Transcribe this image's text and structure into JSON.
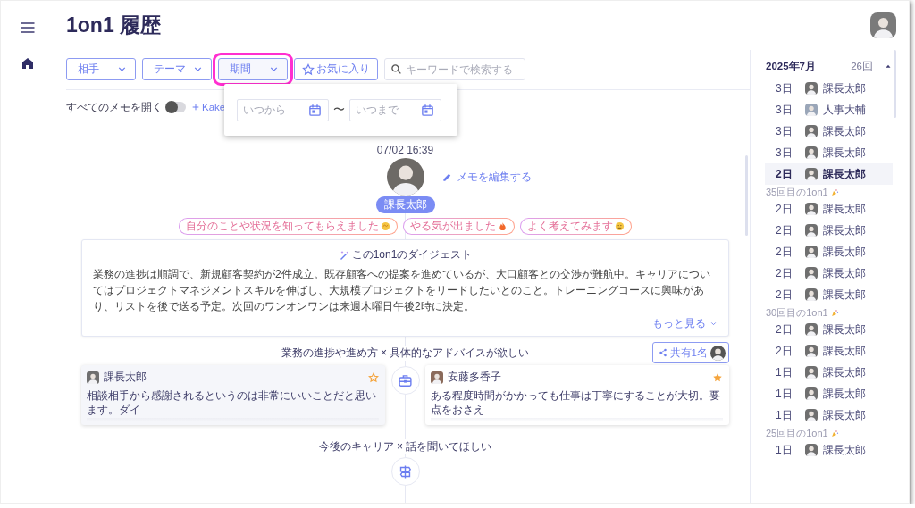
{
  "page": {
    "title": "1on1 履歴"
  },
  "filters": [
    {
      "kind": "dropdown",
      "label": "相手",
      "highlighted": false
    },
    {
      "kind": "dropdown",
      "label": "テーマ",
      "highlighted": false
    },
    {
      "kind": "dropdown",
      "label": "期間",
      "highlighted": true
    },
    {
      "kind": "favorite",
      "label": "お気に入り"
    },
    {
      "kind": "search",
      "placeholder": "キーワードで検索する"
    }
  ],
  "period_popup": {
    "from_placeholder": "いつから",
    "separator": "〜",
    "to_placeholder": "いつまで"
  },
  "options": {
    "open_all_label": "すべてのメモを開く",
    "open_all_on": false,
    "add_link": "Kake"
  },
  "session": {
    "datetime": "07/02 16:39",
    "edit_link": "メモを編集する",
    "name": "課長太郎",
    "reactions": [
      {
        "label": "自分のことや状況を知ってもらえました",
        "kind": "handshake"
      },
      {
        "label": "やる気が出ました",
        "kind": "flame"
      },
      {
        "label": "よく考えてみます",
        "kind": "face"
      }
    ],
    "digest": {
      "title": "この1on1のダイジェスト",
      "text": "業務の進捗は順調で、新規顧客契約が2件成立。既存顧客への提案を進めているが、大口顧客との交渉が難航中。キャリアについてはプロジェクトマネジメントスキルを伸ばし、大規模プロジェクトをリードしたいとのこと。トレーニングコースに興味があり、リストを後で送る予定。次回のワンオンワンは来週木曜日午後2時に決定。",
      "more_link": "もっと見る"
    },
    "topics": [
      {
        "kind": "work",
        "label": "業務の進捗や進め方 × 具体的なアドバイスが欲しい",
        "share": "共有1名",
        "memos": [
          {
            "author": "課長太郎",
            "favorite": false,
            "text": "相談相手から感謝されるというのは非常にいいことだと思います。ダイ"
          },
          {
            "author": "安藤多香子",
            "favorite": true,
            "text": "ある程度時間がかかっても仕事は丁寧にすることが大切。要点をおさえ"
          }
        ]
      },
      {
        "kind": "career",
        "label": "今後のキャリア × 話を聞いてほしい"
      }
    ]
  },
  "history": {
    "month": "2025年7月",
    "count": "26回",
    "expanded": true,
    "items": [
      {
        "kind": "entry",
        "day": "3日",
        "name": "課長太郎",
        "selected": false
      },
      {
        "kind": "entry",
        "day": "3日",
        "name": "人事大輔",
        "selected": false
      },
      {
        "kind": "entry",
        "day": "3日",
        "name": "課長太郎",
        "selected": false
      },
      {
        "kind": "entry",
        "day": "3日",
        "name": "課長太郎",
        "selected": false
      },
      {
        "kind": "entry",
        "day": "2日",
        "name": "課長太郎",
        "selected": true
      },
      {
        "kind": "milestone",
        "label": "35回目の1on1"
      },
      {
        "kind": "entry",
        "day": "2日",
        "name": "課長太郎",
        "selected": false
      },
      {
        "kind": "entry",
        "day": "2日",
        "name": "課長太郎",
        "selected": false
      },
      {
        "kind": "entry",
        "day": "2日",
        "name": "課長太郎",
        "selected": false
      },
      {
        "kind": "entry",
        "day": "2日",
        "name": "課長太郎",
        "selected": false
      },
      {
        "kind": "entry",
        "day": "2日",
        "name": "課長太郎",
        "selected": false
      },
      {
        "kind": "milestone",
        "label": "30回目の1on1"
      },
      {
        "kind": "entry",
        "day": "2日",
        "name": "課長太郎",
        "selected": false
      },
      {
        "kind": "entry",
        "day": "2日",
        "name": "課長太郎",
        "selected": false
      },
      {
        "kind": "entry",
        "day": "1日",
        "name": "課長太郎",
        "selected": false
      },
      {
        "kind": "entry",
        "day": "1日",
        "name": "課長太郎",
        "selected": false
      },
      {
        "kind": "entry",
        "day": "1日",
        "name": "課長太郎",
        "selected": false
      },
      {
        "kind": "milestone",
        "label": "25回目の1on1"
      },
      {
        "kind": "entry",
        "day": "1日",
        "name": "課長太郎",
        "selected": false
      }
    ]
  }
}
